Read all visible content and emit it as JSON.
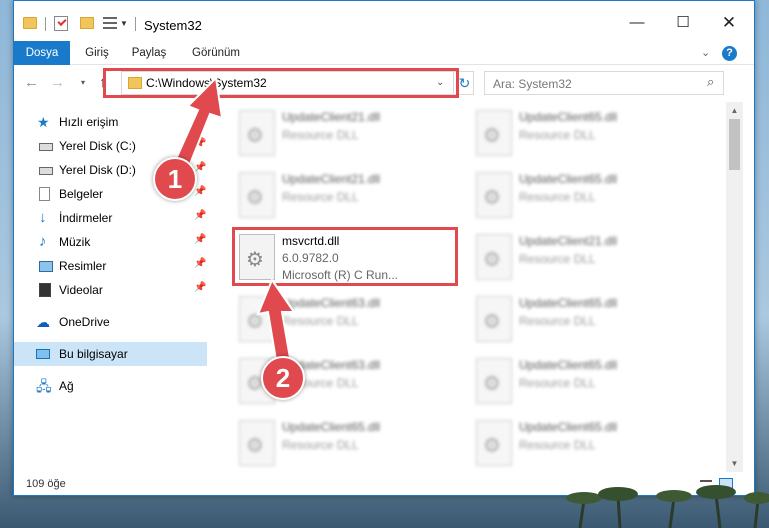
{
  "window": {
    "title": "System32",
    "minimize_label": "—",
    "maximize_label": "☐",
    "close_label": "✕"
  },
  "ribbon": {
    "tabs": [
      "Dosya",
      "Giriş",
      "Paylaş",
      "Görünüm"
    ],
    "expand_glyph": "⌄",
    "help_glyph": "?"
  },
  "navigation": {
    "back_glyph": "←",
    "forward_glyph": "→",
    "recent_glyph": "▾",
    "up_glyph": "↑",
    "address": "C:\\Windows\\System32",
    "address_dropdown": "⌄",
    "refresh_glyph": "↻",
    "search_placeholder": "Ara: System32",
    "search_icon_glyph": "⌕"
  },
  "sidebar": {
    "quick_access": "Hızlı erişim",
    "items": [
      {
        "label": "Yerel Disk (C:)",
        "icon": "drive-icon"
      },
      {
        "label": "Yerel Disk (D:)",
        "icon": "drive-icon"
      },
      {
        "label": "Belgeler",
        "icon": "documents-icon"
      },
      {
        "label": "İndirmeler",
        "icon": "downloads-icon"
      },
      {
        "label": "Müzik",
        "icon": "music-icon"
      },
      {
        "label": "Resimler",
        "icon": "pictures-icon"
      },
      {
        "label": "Videolar",
        "icon": "videos-icon"
      }
    ],
    "onedrive": "OneDrive",
    "this_pc": "Bu bilgisayar",
    "network": "Ağ"
  },
  "files": {
    "left_column": [
      {
        "name": "UpdateClient21.dll",
        "type": "Resource DLL"
      },
      {
        "name": "UpdateClient21.dll",
        "type": "Resource DLL"
      },
      {
        "name": "msvcrtd.dll",
        "version": "6.0.9782.0",
        "description": "Microsoft (R) C Run..."
      },
      {
        "name": "UpdateClient63.dll",
        "type": "Resource DLL"
      },
      {
        "name": "UpdateClient63.dll",
        "type": "Resource DLL"
      },
      {
        "name": "UpdateClient65.dll",
        "type": "Resource DLL"
      }
    ],
    "right_column": [
      {
        "name": "UpdateClient65.dll",
        "type": "Resource DLL"
      },
      {
        "name": "UpdateClient65.dll",
        "type": "Resource DLL"
      },
      {
        "name": "UpdateClient21.dll",
        "type": "Resource DLL"
      },
      {
        "name": "UpdateClient65.dll",
        "type": "Resource DLL"
      },
      {
        "name": "UpdateClient65.dll",
        "type": "Resource DLL"
      },
      {
        "name": "UpdateClient65.dll",
        "type": "Resource DLL"
      }
    ]
  },
  "status": {
    "item_count": "109 öğe"
  },
  "annotations": {
    "marker1": "1",
    "marker2": "2",
    "color": "#e04a4f"
  },
  "colors": {
    "accent": "#1979ca",
    "selection": "#cce4f7"
  }
}
